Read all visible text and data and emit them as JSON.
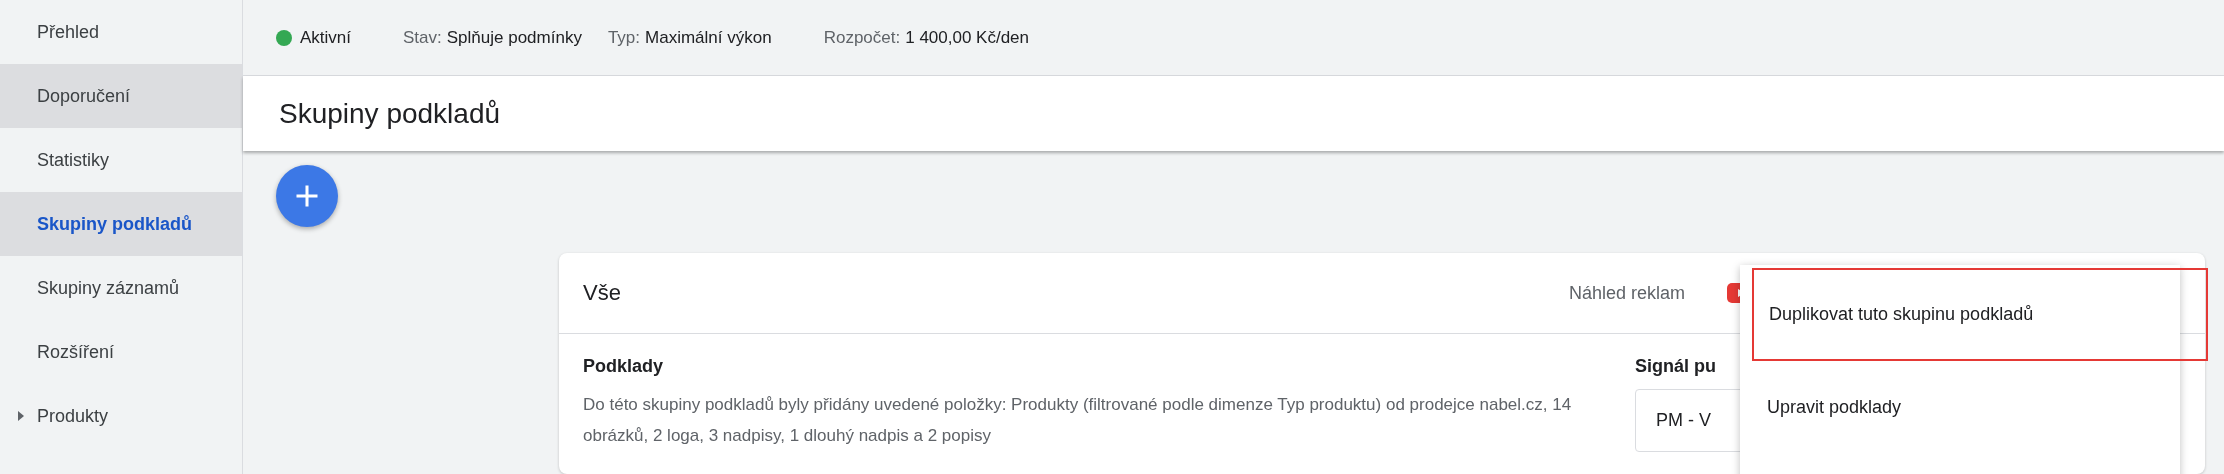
{
  "sidebar": {
    "items": [
      {
        "label": "Přehled",
        "selected": false,
        "hovered": false,
        "expandable": false
      },
      {
        "label": "Doporučení",
        "selected": false,
        "hovered": true,
        "expandable": false
      },
      {
        "label": "Statistiky",
        "selected": false,
        "hovered": false,
        "expandable": false
      },
      {
        "label": "Skupiny podkladů",
        "selected": true,
        "hovered": false,
        "expandable": false
      },
      {
        "label": "Skupiny záznamů",
        "selected": false,
        "hovered": false,
        "expandable": false
      },
      {
        "label": "Rozšíření",
        "selected": false,
        "hovered": false,
        "expandable": false
      },
      {
        "label": "Produkty",
        "selected": false,
        "hovered": false,
        "expandable": true
      }
    ]
  },
  "status_bar": {
    "status": {
      "label": "Aktivní",
      "color": "#34a853"
    },
    "fields": [
      {
        "label": "Stav:",
        "value": "Splňuje podmínky"
      },
      {
        "label": "Typ:",
        "value": "Maximální výkon"
      },
      {
        "label": "Rozpočet:",
        "value": "1 400,00 Kč/den"
      }
    ]
  },
  "page_title": "Skupiny podkladů",
  "card": {
    "title": "Vše",
    "preview_label": "Náhled reklam",
    "assets": {
      "heading": "Podklady",
      "description": "Do této skupiny podkladů byly přidány uvedené položky: Produkty (filtrované podle dimenze Typ produktu) od prodejce nabel.cz, 14 obrázků, 2 loga, 3 nadpisy, 1 dlouhý nadpis a 2 popisy"
    },
    "signal": {
      "heading": "Signál pu",
      "value": "PM - V"
    }
  },
  "menu": {
    "items": [
      {
        "label": "Duplikovat tuto skupinu podkladů",
        "highlighted": true
      },
      {
        "label": "Upravit podklady",
        "highlighted": false
      }
    ]
  }
}
